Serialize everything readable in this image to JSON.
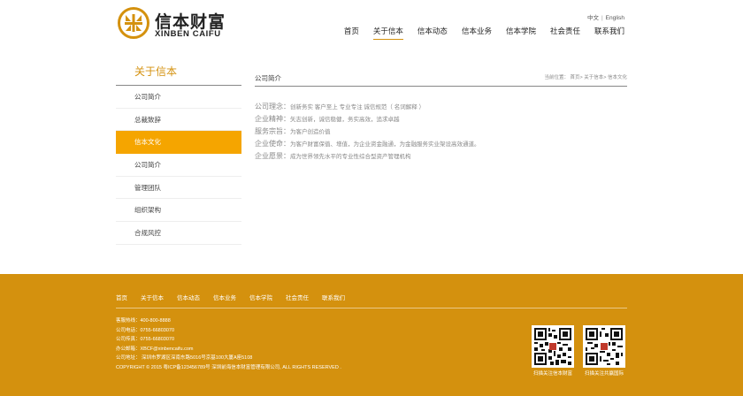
{
  "brand": {
    "name_cn": "信本财富",
    "name_en": "XINBEN CAIFU",
    "color": "#d4910e"
  },
  "lang": {
    "cn": "中文",
    "en": "English"
  },
  "nav": [
    {
      "label": "首页",
      "active": false
    },
    {
      "label": "关于信本",
      "active": true
    },
    {
      "label": "信本动态",
      "active": false
    },
    {
      "label": "信本业务",
      "active": false
    },
    {
      "label": "信本学院",
      "active": false
    },
    {
      "label": "社会责任",
      "active": false
    },
    {
      "label": "联系我们",
      "active": false
    }
  ],
  "sidebar": {
    "title": "关于信本",
    "items": [
      {
        "label": "公司简介",
        "active": false
      },
      {
        "label": "总裁致辞",
        "active": false
      },
      {
        "label": "信本文化",
        "active": true
      },
      {
        "label": "公司简介",
        "active": false
      },
      {
        "label": "管理团队",
        "active": false
      },
      {
        "label": "组织架构",
        "active": false
      },
      {
        "label": "合规风控",
        "active": false
      }
    ]
  },
  "main": {
    "title": "公司简介",
    "breadcrumb": "当前位置： 首页> 关于信本> 信本文化",
    "lines": [
      {
        "label": "公司理念：",
        "text": "创新务实 客户至上 专业专注 诚信规范（ 名词解释 ）"
      },
      {
        "label": "企业精神：",
        "text": "矢志创新，诚信稳健，务实高效，追求卓越"
      },
      {
        "label": "服务宗旨：",
        "text": "为客户创造价值"
      },
      {
        "label": "企业使命：",
        "text": "为客户财富保值、增值，为企业资金融通，为金融服务实业架设高效通道。"
      },
      {
        "label": "企业愿景：",
        "text": "成为世界领先水平的专业性综合型资产管理机构"
      }
    ]
  },
  "footer": {
    "nav": [
      "首页",
      "关于信本",
      "信本动态",
      "信本业务",
      "信本学院",
      "社会责任",
      "联系我们"
    ],
    "info": [
      "客服热线：400-800-8888",
      "公司电话：0755-66803070",
      "公司传真：0755-66803070",
      "办公邮箱：XBCF@xinbencaifu.com",
      "公司地址： 深圳市罗湖区深南东路5016号京基100大厦A座5108",
      "COPYRIGHT © 2015 粤ICP备123456789号 深圳前海信本财富管理有限公司, ALL RIGHTS RESERVED ."
    ],
    "qr": [
      {
        "caption": "扫描关注信本财富"
      },
      {
        "caption": "扫描关注共赢国际"
      }
    ]
  }
}
